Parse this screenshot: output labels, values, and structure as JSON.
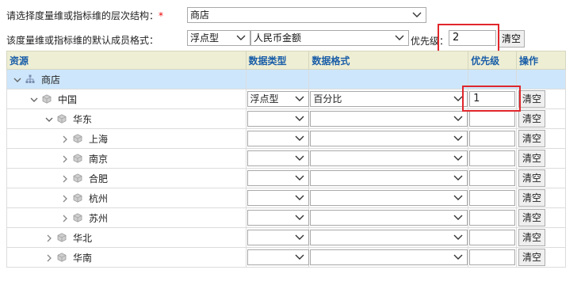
{
  "form": {
    "hierarchy_label": "请选择度量维或指标维的层次结构：",
    "required_mark": "*",
    "hierarchy_value": "商店",
    "default_format_label": "该度量维或指标维的默认成员格式：",
    "data_type_value": "浮点型",
    "data_format_value": "人民币金额",
    "priority_label": "优先级：",
    "priority_value": "2",
    "clear_label": "清空"
  },
  "table": {
    "headers": [
      "资源",
      "数据类型",
      "数据格式",
      "优先级",
      "操作"
    ],
    "rows": [
      {
        "name": "商店",
        "level": 0,
        "expand": "down",
        "icon": "hierarchy",
        "selected": true,
        "controls": false
      },
      {
        "name": "中国",
        "level": 1,
        "expand": "down",
        "icon": "member",
        "controls": true,
        "data_type": "浮点型",
        "data_format": "百分比",
        "priority": "1",
        "op": "清空"
      },
      {
        "name": "华东",
        "level": 2,
        "expand": "down",
        "icon": "member",
        "controls": true,
        "data_type": "",
        "data_format": "",
        "priority": "",
        "op": "清空"
      },
      {
        "name": "上海",
        "level": 3,
        "expand": "right",
        "icon": "member",
        "controls": true,
        "data_type": "",
        "data_format": "",
        "priority": "",
        "op": "清空"
      },
      {
        "name": "南京",
        "level": 3,
        "expand": "right",
        "icon": "member",
        "controls": true,
        "data_type": "",
        "data_format": "",
        "priority": "",
        "op": "清空"
      },
      {
        "name": "合肥",
        "level": 3,
        "expand": "right",
        "icon": "member",
        "controls": true,
        "data_type": "",
        "data_format": "",
        "priority": "",
        "op": "清空"
      },
      {
        "name": "杭州",
        "level": 3,
        "expand": "right",
        "icon": "member",
        "controls": true,
        "data_type": "",
        "data_format": "",
        "priority": "",
        "op": "清空"
      },
      {
        "name": "苏州",
        "level": 3,
        "expand": "right",
        "icon": "member",
        "controls": true,
        "data_type": "",
        "data_format": "",
        "priority": "",
        "op": "清空"
      },
      {
        "name": "华北",
        "level": 2,
        "expand": "right",
        "icon": "member",
        "controls": true,
        "data_type": "",
        "data_format": "",
        "priority": "",
        "op": "清空"
      },
      {
        "name": "华南",
        "level": 2,
        "expand": "right",
        "icon": "member",
        "controls": true,
        "data_type": "",
        "data_format": "",
        "priority": "",
        "op": "清空"
      }
    ]
  },
  "colors": {
    "header_bg": "#eeeed4",
    "header_text": "#1a5ea8",
    "selected_row": "#cde6fb",
    "highlight_box": "#e0262b"
  }
}
